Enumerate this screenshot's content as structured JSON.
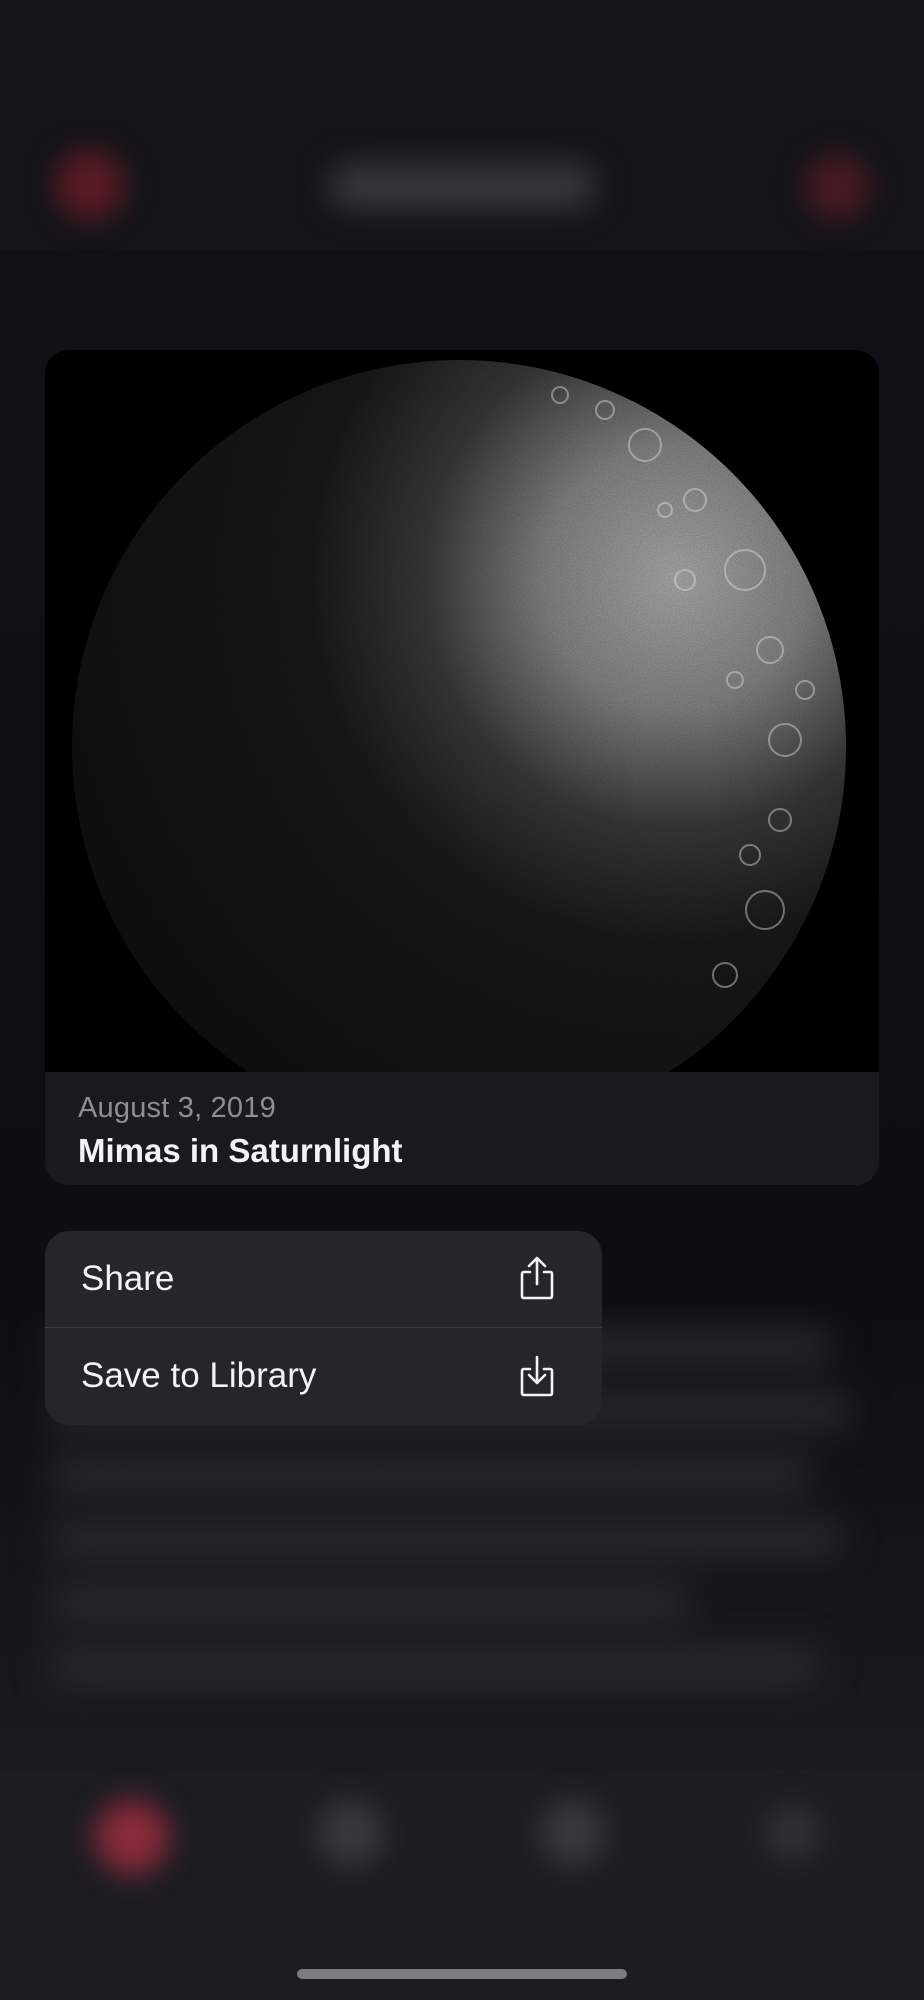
{
  "card": {
    "date": "August 3, 2019",
    "title": "Mimas in Saturnlight"
  },
  "menu": {
    "items": [
      {
        "label": "Share",
        "icon": "share-icon"
      },
      {
        "label": "Save to Library",
        "icon": "save-to-library-icon"
      }
    ]
  },
  "colors": {
    "accent": "#c0304a",
    "menu_background": "#262628",
    "card_background": "#1a1a1c",
    "text_primary": "#f2f2f7",
    "text_secondary": "#8e8e93"
  }
}
